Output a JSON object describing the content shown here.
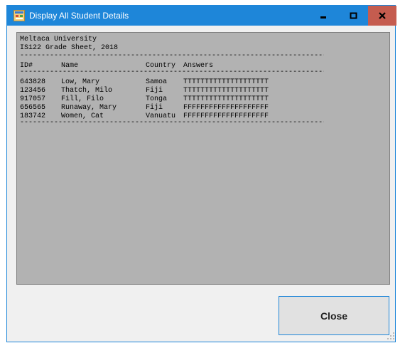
{
  "window": {
    "title": "Display All Student Details",
    "titlebar_color": "#1e86d9",
    "close_button_color": "#c55c4f"
  },
  "titlebar_buttons": {
    "minimize_icon": "minimize-icon",
    "maximize_icon": "maximize-icon",
    "close_label": "x"
  },
  "report": {
    "university": "Meltaca University",
    "sheet_title": "IS122 Grade Sheet, 2018",
    "separator": "-----------------------------------------------------------------------------",
    "headers": {
      "id": "ID#",
      "name": "Name",
      "country": "Country",
      "answers": "Answers"
    },
    "rows": [
      {
        "id": "643828",
        "name": "Low, Mary",
        "country": "Samoa",
        "answers": "TTTTTTTTTTTTTTTTTTTT"
      },
      {
        "id": "123456",
        "name": "Thatch, Milo",
        "country": "Fiji",
        "answers": "TTTTTTTTTTTTTTTTTTTT"
      },
      {
        "id": "917057",
        "name": "Fill, Filo",
        "country": "Tonga",
        "answers": "TTTTTTTTTTTTTTTTTTTT"
      },
      {
        "id": "656565",
        "name": "Runaway, Mary",
        "country": "Fiji",
        "answers": "FFFFFFFFFFFFFFFFFFFF"
      },
      {
        "id": "183742",
        "name": "Women, Cat",
        "country": "Vanuatu",
        "answers": "FFFFFFFFFFFFFFFFFFFF"
      }
    ],
    "background_color": "#b2b2b2"
  },
  "actions": {
    "close_label": "Close"
  }
}
